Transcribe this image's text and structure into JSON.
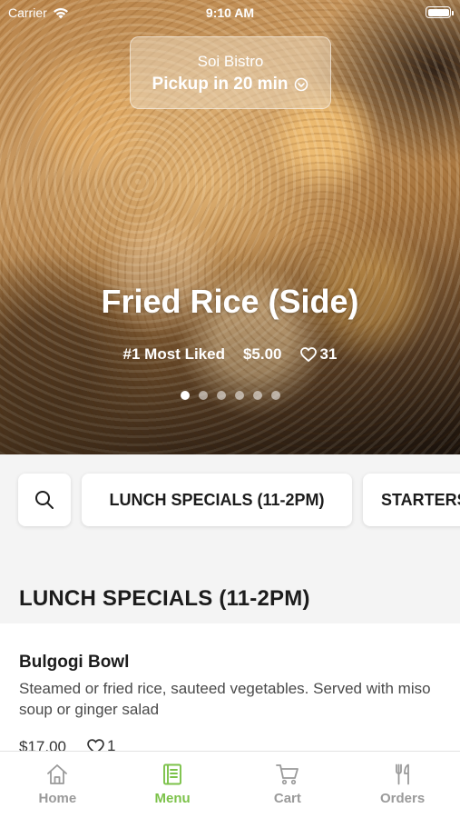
{
  "status_bar": {
    "carrier": "Carrier",
    "time": "9:10 AM"
  },
  "pickup": {
    "restaurant_name": "Soi Bistro",
    "pickup_text": "Pickup in 20 min"
  },
  "featured": {
    "title": "Fried Rice (Side)",
    "badge": "#1 Most Liked",
    "price": "$5.00",
    "likes": "31",
    "carousel_total": 6,
    "carousel_active": 1
  },
  "categories": {
    "chip_1": "LUNCH SPECIALS (11-2PM)",
    "chip_2": "STARTERS"
  },
  "section": {
    "heading": "LUNCH SPECIALS (11-2PM)"
  },
  "item": {
    "name": "Bulgogi Bowl",
    "description": "Steamed or fried rice, sauteed vegetables. Served with miso soup or ginger salad",
    "price": "$17.00",
    "likes": "1"
  },
  "tabs": {
    "home": "Home",
    "menu": "Menu",
    "cart": "Cart",
    "orders": "Orders",
    "active": "menu"
  },
  "colors": {
    "accent": "#7cc24a",
    "tab_inactive": "#9a9a9a"
  }
}
